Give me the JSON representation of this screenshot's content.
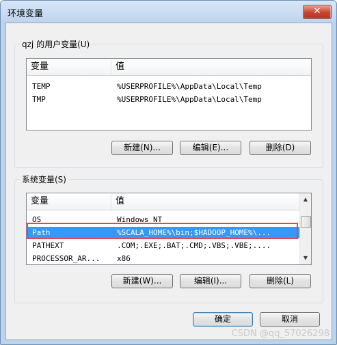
{
  "window": {
    "title": "环境变量",
    "close_glyph": "✕"
  },
  "user_group": {
    "label": "qzj 的用户变量(U)",
    "columns": [
      "变量",
      "值"
    ],
    "rows": [
      {
        "name": "TEMP",
        "value": "%USERPROFILE%\\AppData\\Local\\Temp"
      },
      {
        "name": "TMP",
        "value": "%USERPROFILE%\\AppData\\Local\\Temp"
      }
    ],
    "buttons": {
      "new": "新建(N)...",
      "edit": "编辑(E)...",
      "delete": "删除(D)"
    }
  },
  "system_group": {
    "label": "系统变量(S)",
    "columns": [
      "变量",
      "值"
    ],
    "rows": [
      {
        "name": "OS",
        "value": "Windows_NT"
      },
      {
        "name": "Path",
        "value": "%SCALA_HOME%\\bin;$HADOOP_HOME%\\...",
        "selected": true
      },
      {
        "name": "PATHEXT",
        "value": ".COM;.EXE;.BAT;.CMD;.VBS;.VBE;...."
      },
      {
        "name": "PROCESSOR_AR...",
        "value": "x86"
      }
    ],
    "buttons": {
      "new": "新建(W)...",
      "edit": "编辑(I)...",
      "delete": "删除(L)"
    }
  },
  "footer": {
    "ok": "确定",
    "cancel": "取消"
  },
  "watermark": "CSDN @qq_57026298",
  "colors": {
    "selection": "#3399ff",
    "highlight_box": "#e0474f",
    "close_button": "#c8452f"
  }
}
